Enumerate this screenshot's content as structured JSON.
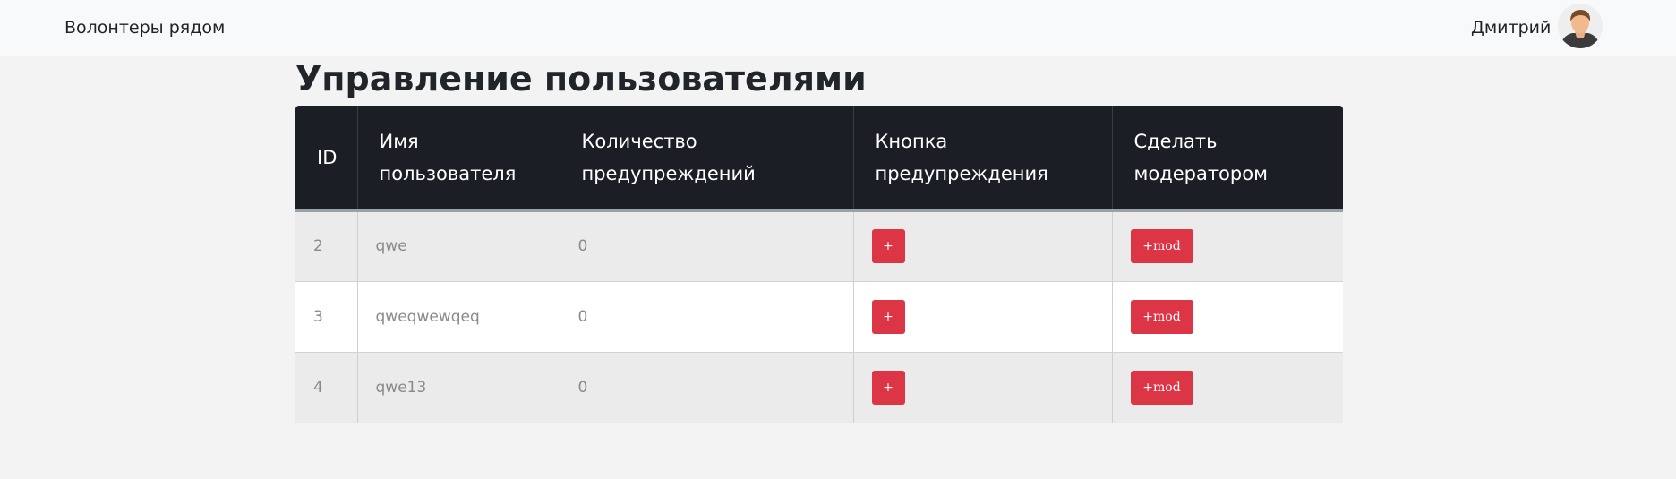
{
  "navbar": {
    "brand": "Волонтеры рядом",
    "user_name": "Дмитрий",
    "avatar_icon": "user-avatar-icon"
  },
  "page": {
    "title": "Управление пользователями"
  },
  "table": {
    "headers": [
      "ID",
      "Имя пользователя",
      "Количество предупреждений",
      "Кнопка предупреждения",
      "Сделать модератором"
    ],
    "rows": [
      {
        "id": "2",
        "username": "qwe",
        "warnings": "0",
        "warn_label": "+",
        "mod_label": "+mod"
      },
      {
        "id": "3",
        "username": "qweqwewqeq",
        "warnings": "0",
        "warn_label": "+",
        "mod_label": "+mod"
      },
      {
        "id": "4",
        "username": "qwe13",
        "warnings": "0",
        "warn_label": "+",
        "mod_label": "+mod"
      }
    ]
  },
  "colors": {
    "header_bg": "#1b1e24",
    "danger": "#dc3545",
    "row_odd": "#ebebeb",
    "row_even": "#ffffff"
  }
}
